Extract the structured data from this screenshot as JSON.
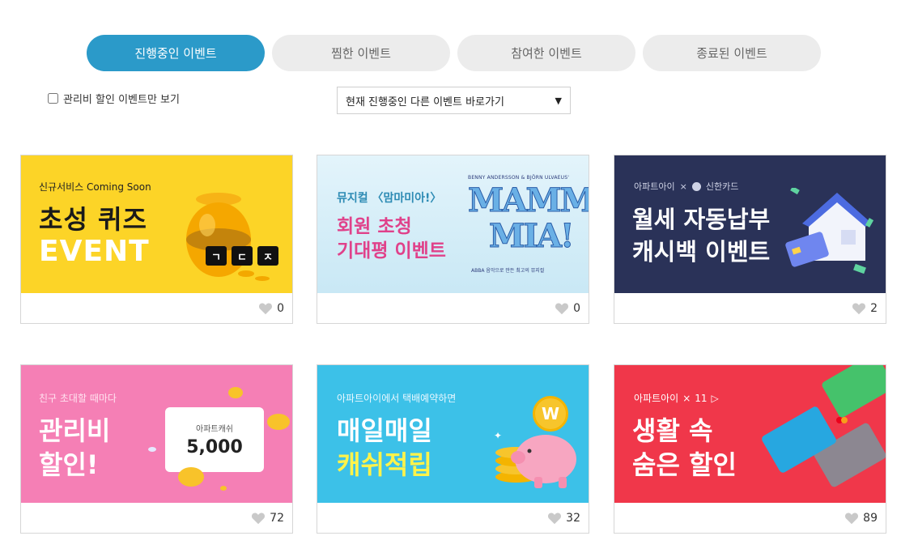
{
  "tabs": [
    {
      "label": "진행중인 이벤트",
      "active": true
    },
    {
      "label": "찜한 이벤트",
      "active": false
    },
    {
      "label": "참여한 이벤트",
      "active": false
    },
    {
      "label": "종료된 이벤트",
      "active": false
    }
  ],
  "filter": {
    "label": "관리비 할인 이벤트만 보기",
    "checked": false
  },
  "select": {
    "selected": "현재 진행중인 다른 이벤트 바로가기"
  },
  "events": [
    {
      "small": "신규서비스 Coming Soon",
      "line1": "초성 퀴즈",
      "line2": "EVENT",
      "tiles": [
        "ㄱ",
        "ㄷ",
        "ㅈ"
      ],
      "likes": "0",
      "bg": "#fcd427"
    },
    {
      "small": "뮤지컬 〈맘마미아!〉",
      "line1": "회원 초청",
      "line2": "기대평 이벤트",
      "credit": "BENNY ANDERSSON & BJÖRN ULVAEUS'",
      "logo1": "MAMMA",
      "logo2": "MIA!",
      "tagline": "ABBA 음악으로 만든 최고의 뮤지컬",
      "likes": "0",
      "bg": "#d5eef8"
    },
    {
      "small": "아파트아이",
      "partner": "신한카드",
      "line1": "월세 자동납부",
      "line2": "캐시백 이벤트",
      "likes": "2",
      "bg": "#2a3258"
    },
    {
      "small": "친구 초대할 때마다",
      "line1": "관리비",
      "line2": "할인!",
      "ticket_label": "아파트캐쉬",
      "ticket_value": "5,000",
      "likes": "72",
      "bg": "#f57fb5"
    },
    {
      "small": "아파트아이에서 택배예약하면",
      "line1": "매일매일",
      "line2": "캐쉬적립",
      "coin": "W",
      "likes": "32",
      "bg": "#3cc1e8"
    },
    {
      "small": "아파트아이",
      "partner": "11",
      "line1": "생활 속",
      "line2": "숨은 할인",
      "likes": "89",
      "bg": "#f0374a"
    }
  ]
}
